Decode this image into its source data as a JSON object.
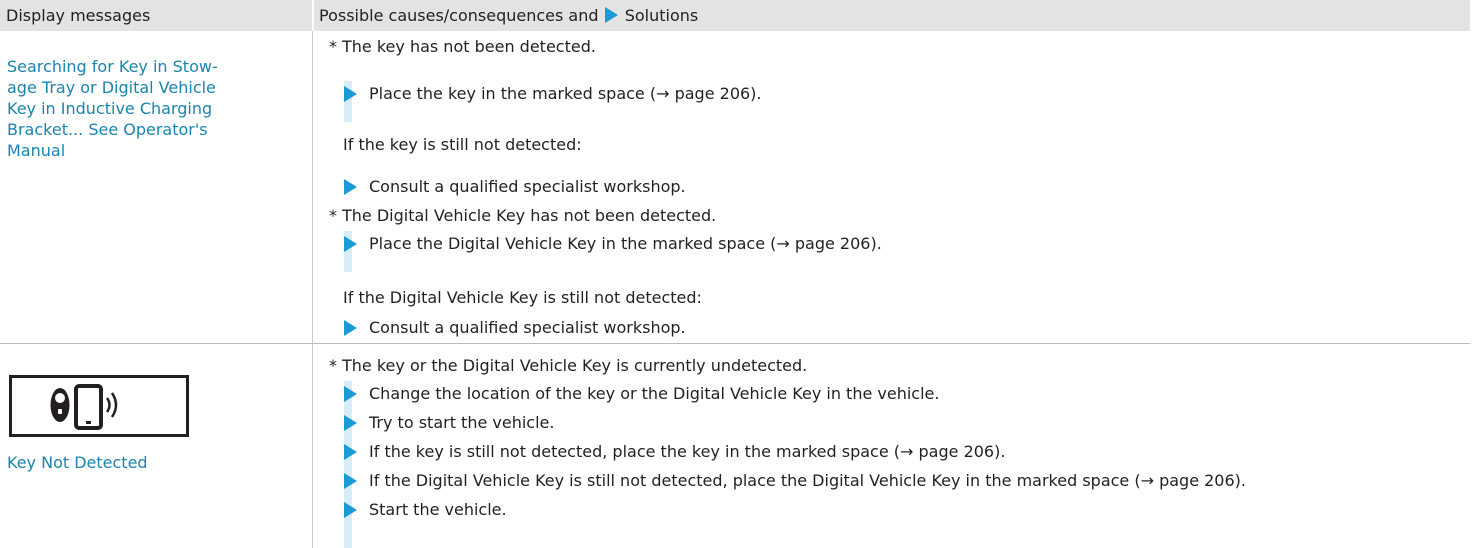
{
  "header": {
    "col1": "Display messages",
    "col2_before": "Possible causes/consequences and",
    "col2_after": "Solutions",
    "accent_color": "#1c9ad6"
  },
  "rows": [
    {
      "message_lines": [
        "Searching for Key in Stow-",
        "age Tray or Digital Vehicle",
        "Key in Inductive Charging",
        "Bracket... See Operator's",
        "Manual"
      ],
      "items": [
        {
          "kind": "cause",
          "text": "The key has not been detected."
        },
        {
          "kind": "solution",
          "text": "Place the key in the marked space (→ page 206)."
        },
        {
          "kind": "note",
          "text": "If the key is still not detected:"
        },
        {
          "kind": "solution",
          "text": "Consult a qualified specialist workshop."
        },
        {
          "kind": "cause",
          "text": "The Digital Vehicle Key has not been detected."
        },
        {
          "kind": "solution",
          "text": "Place the Digital Vehicle Key in the marked space (→ page 206)."
        },
        {
          "kind": "note",
          "text": "If the Digital Vehicle Key is still not detected:"
        },
        {
          "kind": "solution",
          "text": "Consult a qualified specialist workshop."
        }
      ]
    },
    {
      "icon": "key-phone-signal-icon",
      "message": "Key Not Detected",
      "items": [
        {
          "kind": "cause",
          "text": "The key or the Digital Vehicle Key is currently undetected."
        },
        {
          "kind": "solution",
          "text": "Change the location of the key or the Digital Vehicle Key in the vehicle."
        },
        {
          "kind": "solution",
          "text": "Try to start the vehicle."
        },
        {
          "kind": "solution",
          "text": "If the key is still not detected, place the key in the marked space (→ page 206)."
        },
        {
          "kind": "solution",
          "text": "If the Digital Vehicle Key is still not detected, place the Digital Vehicle Key in the marked space (→ page 206)."
        },
        {
          "kind": "solution",
          "text": "Start the vehicle."
        }
      ]
    }
  ]
}
